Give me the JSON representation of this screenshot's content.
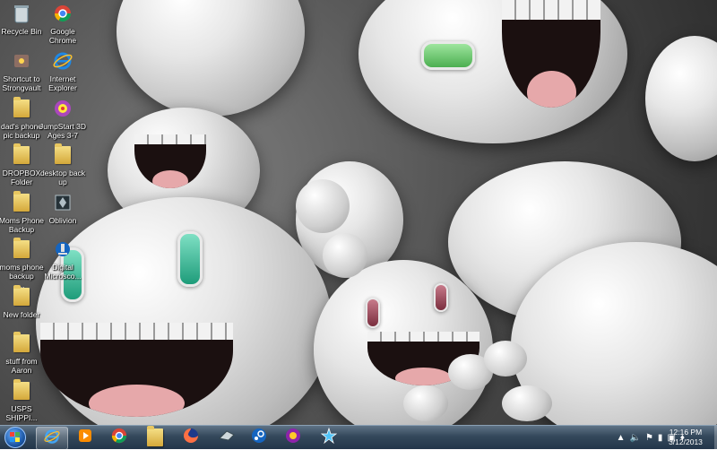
{
  "desktop": {
    "icons": [
      {
        "label": "Recycle Bin",
        "icon": "recycle-bin-icon"
      },
      {
        "label": "Google\nChrome",
        "icon": "chrome-icon"
      },
      {
        "label": "Shortcut to\nStrongvault",
        "icon": "strongvault-icon"
      },
      {
        "label": "Internet\nExplorer",
        "icon": "internet-explorer-icon"
      },
      {
        "label": "dad's phone\npic backup",
        "icon": "folder-icon"
      },
      {
        "label": "JumpStart 3D\nAges 3-7",
        "icon": "jumpstart-icon"
      },
      {
        "label": "DROPBOX\nFolder",
        "icon": "folder-icon"
      },
      {
        "label": "desktop back\nup",
        "icon": "folder-icon"
      },
      {
        "label": "Moms Phone\nBackup",
        "icon": "folder-icon"
      },
      {
        "label": "Oblivion",
        "icon": "oblivion-icon"
      },
      {
        "label": "moms phone\nbackup\n...",
        "icon": "folder-icon"
      },
      {
        "label": "Digital\nMicrosco...",
        "icon": "digital-microscope-icon"
      },
      {
        "label": "New folder",
        "icon": "folder-icon"
      },
      {
        "label": "stuff from\nAaron",
        "icon": "folder-icon"
      },
      {
        "label": "USPS\nSHIPPI...",
        "icon": "folder-icon"
      }
    ]
  },
  "taskbar": {
    "pinned": [
      {
        "name": "internet-explorer",
        "icon": "internet-explorer-icon",
        "active": true
      },
      {
        "name": "media-player",
        "icon": "media-player-icon",
        "active": false
      },
      {
        "name": "chrome",
        "icon": "chrome-icon",
        "active": false
      },
      {
        "name": "file-explorer",
        "icon": "folder-icon",
        "active": false
      },
      {
        "name": "firefox",
        "icon": "firefox-icon",
        "active": false
      },
      {
        "name": "game",
        "icon": "game-icon",
        "active": false
      },
      {
        "name": "steam",
        "icon": "steam-icon",
        "active": false
      },
      {
        "name": "game-2",
        "icon": "game-2-icon",
        "active": false
      },
      {
        "name": "star-app",
        "icon": "star-icon",
        "active": false
      }
    ],
    "tray": {
      "time": "12:16 PM",
      "date": "3/12/2013"
    }
  }
}
